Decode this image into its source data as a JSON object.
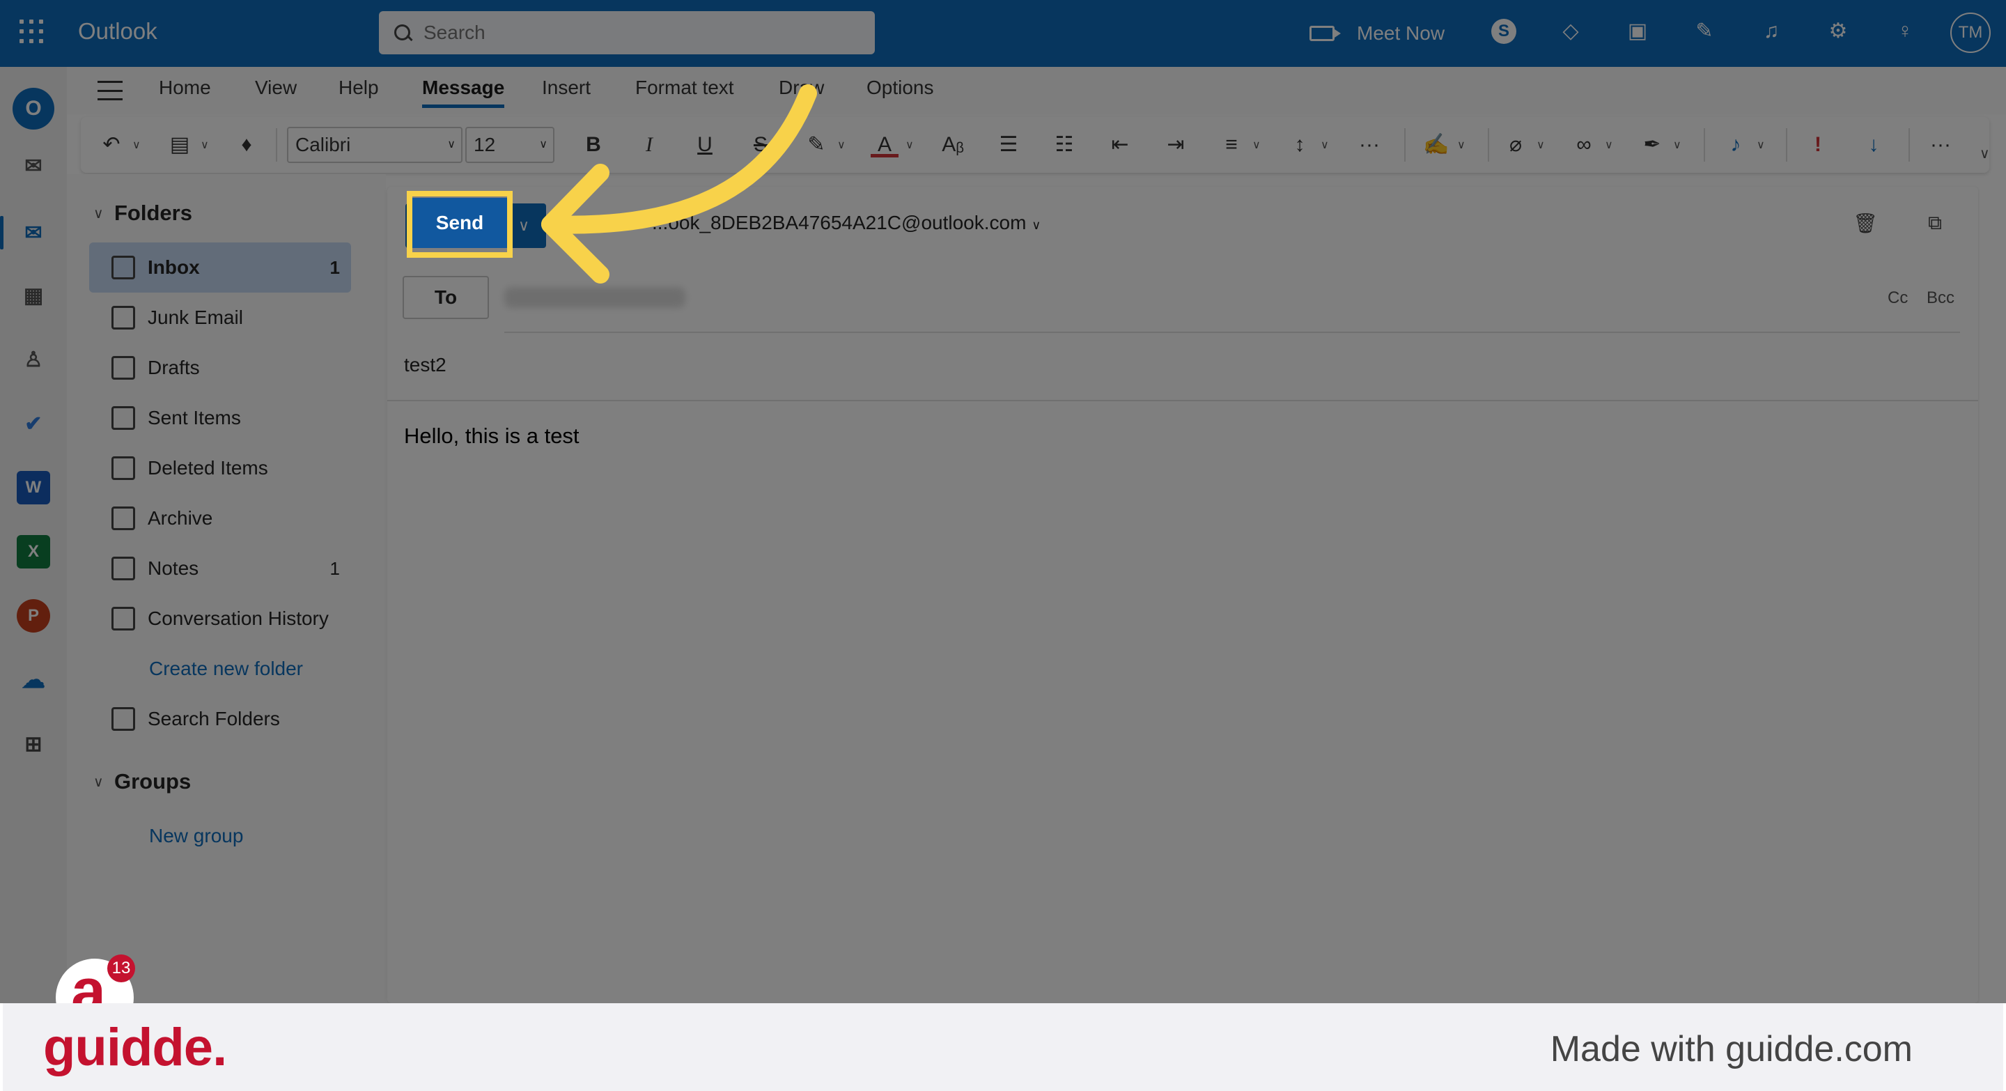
{
  "app": {
    "title": "Outlook"
  },
  "search": {
    "placeholder": "Search"
  },
  "topbar": {
    "meet_now": "Meet Now",
    "icons": [
      "skype-icon",
      "diamond-icon",
      "office-icon",
      "notes-icon",
      "bell-icon",
      "gear-icon",
      "lightbulb-icon"
    ],
    "avatar_initials": "TM"
  },
  "rail": {
    "items": [
      "outlook-icon",
      "new-mail-icon",
      "mail-icon",
      "calendar-icon",
      "people-icon",
      "todo-icon",
      "word-icon",
      "excel-icon",
      "powerpoint-icon",
      "onedrive-icon",
      "apps-icon"
    ]
  },
  "ribbon": {
    "tabs": [
      "Home",
      "View",
      "Help",
      "Message",
      "Insert",
      "Format text",
      "Draw",
      "Options"
    ],
    "active_tab": "Message",
    "font_name": "Calibri",
    "font_size": "12"
  },
  "folders": {
    "header": "Folders",
    "items": [
      {
        "label": "Inbox",
        "count": "1"
      },
      {
        "label": "Junk Email",
        "count": ""
      },
      {
        "label": "Drafts",
        "count": ""
      },
      {
        "label": "Sent Items",
        "count": ""
      },
      {
        "label": "Deleted Items",
        "count": ""
      },
      {
        "label": "Archive",
        "count": ""
      },
      {
        "label": "Notes",
        "count": "1"
      },
      {
        "label": "Conversation History",
        "count": ""
      }
    ],
    "create_new": "Create new folder",
    "search_folders": "Search Folders",
    "groups_header": "Groups",
    "new_group": "New group"
  },
  "compose": {
    "send_label": "Send",
    "from": "...ook_8DEB2BA47654A21C@outlook.com",
    "to_label": "To",
    "cc": "Cc",
    "bcc": "Bcc",
    "subject": "test2",
    "body": "Hello, this is a test"
  },
  "guidde": {
    "logo": "guidde.",
    "made_with": "Made with guidde.com",
    "badge_letter": "a",
    "badge_count": "13"
  },
  "colors": {
    "brand": "#0f6cbd",
    "highlight": "#f8d24a",
    "guidde_red": "#c4122f"
  }
}
